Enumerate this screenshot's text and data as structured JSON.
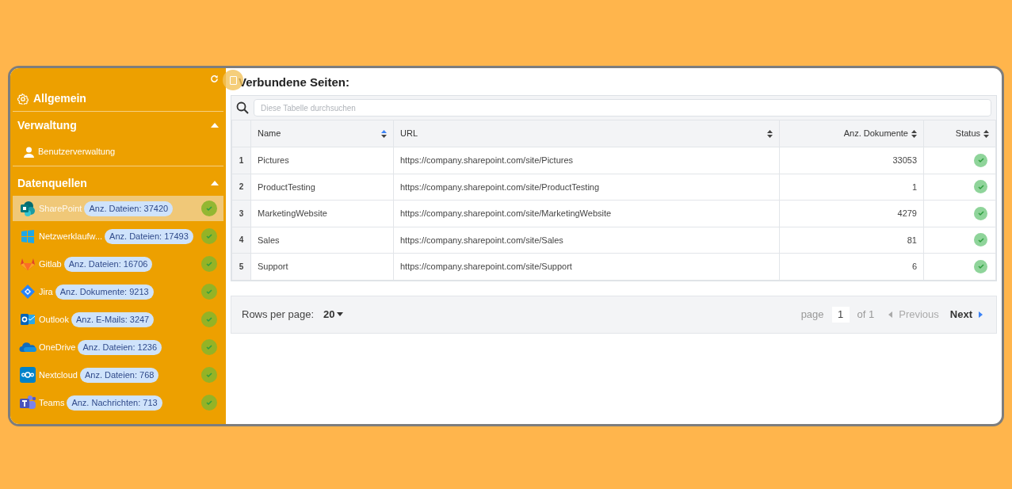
{
  "sidebar": {
    "general": {
      "label": "Allgemein"
    },
    "sections": [
      {
        "title": "Verwaltung",
        "expanded": true,
        "items": [
          {
            "label": "Benutzerverwaltung"
          }
        ]
      },
      {
        "title": "Datenquellen",
        "expanded": true,
        "sources": [
          {
            "kind": "sharepoint",
            "name": "SharePoint",
            "count": "Anz. Dateien: 37420",
            "ok": true,
            "selected": true
          },
          {
            "kind": "windows",
            "name": "Netzwerklaufw...",
            "count": "Anz. Dateien: 17493",
            "ok": true,
            "selected": false
          },
          {
            "kind": "gitlab",
            "name": "Gitlab",
            "count": "Anz. Dateien: 16706",
            "ok": true,
            "selected": false
          },
          {
            "kind": "jira",
            "name": "Jira",
            "count": "Anz. Dokumente: 9213",
            "ok": true,
            "selected": false
          },
          {
            "kind": "outlook",
            "name": "Outlook",
            "count": "Anz. E-Mails: 3247",
            "ok": true,
            "selected": false
          },
          {
            "kind": "onedrive",
            "name": "OneDrive",
            "count": "Anz. Dateien: 1236",
            "ok": true,
            "selected": false
          },
          {
            "kind": "nextcloud",
            "name": "Nextcloud",
            "count": "Anz. Dateien: 768",
            "ok": true,
            "selected": false
          },
          {
            "kind": "teams",
            "name": "Teams",
            "count": "Anz. Nachrichten: 713",
            "ok": true,
            "selected": false
          }
        ]
      }
    ]
  },
  "main": {
    "title": "Verbundene Seiten:",
    "search": {
      "placeholder": "Diese Tabelle durchsuchen"
    },
    "table": {
      "columns": [
        "Name",
        "URL",
        "Anz. Dokumente",
        "Status"
      ],
      "rows": [
        {
          "index": "1",
          "name": "Pictures",
          "url": "https://company.sharepoint.com/site/Pictures",
          "documents": "33053",
          "ok": true
        },
        {
          "index": "2",
          "name": "ProductTesting",
          "url": "https://company.sharepoint.com/site/ProductTesting",
          "documents": "1",
          "ok": true
        },
        {
          "index": "3",
          "name": "MarketingWebsite",
          "url": "https://company.sharepoint.com/site/MarketingWebsite",
          "documents": "4279",
          "ok": true
        },
        {
          "index": "4",
          "name": "Sales",
          "url": "https://company.sharepoint.com/site/Sales",
          "documents": "81",
          "ok": true
        },
        {
          "index": "5",
          "name": "Support",
          "url": "https://company.sharepoint.com/site/Support",
          "documents": "6",
          "ok": true
        }
      ]
    },
    "pagination": {
      "rows_label": "Rows per page:",
      "rows_value": "20",
      "page_label": "page",
      "page": "1",
      "of": "of 1",
      "previous": "Previous",
      "next": "Next"
    }
  }
}
